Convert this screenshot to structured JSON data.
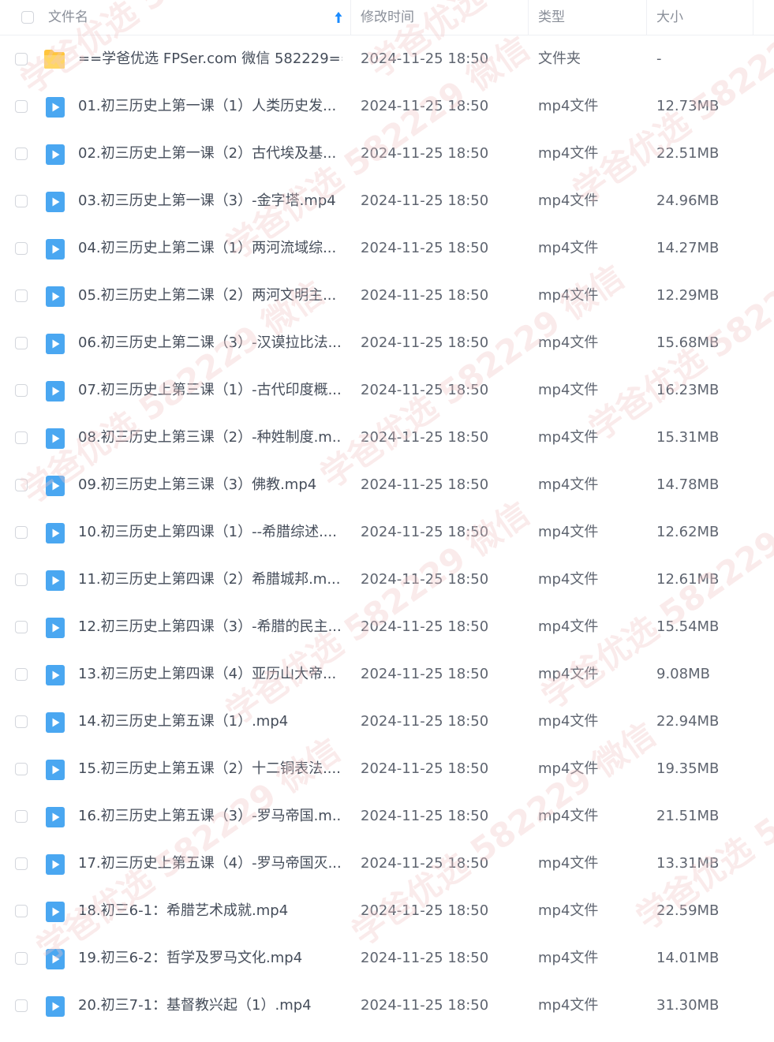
{
  "colors": {
    "accent": "#1a8bff",
    "video_icon": "#4aa7f1",
    "folder": "#ffc53d",
    "watermark": "#f0c5c5"
  },
  "header": {
    "name_label": "文件名",
    "time_label": "修改时间",
    "type_label": "类型",
    "size_label": "大小",
    "sort_icon": "arrow-up-icon"
  },
  "watermark": {
    "text": "学爸优选 582229 微信"
  },
  "files": [
    {
      "icon": "folder-icon",
      "name": "==学爸优选 FPSer.com 微信 582229==",
      "time": "2024-11-25 18:50",
      "type": "文件夹",
      "size": "-"
    },
    {
      "icon": "video-icon",
      "name": "01.初三历史上第一课（1）人类历史发...",
      "time": "2024-11-25 18:50",
      "type": "mp4文件",
      "size": "12.73MB"
    },
    {
      "icon": "video-icon",
      "name": "02.初三历史上第一课（2）古代埃及基...",
      "time": "2024-11-25 18:50",
      "type": "mp4文件",
      "size": "22.51MB"
    },
    {
      "icon": "video-icon",
      "name": "03.初三历史上第一课（3）-金字塔.mp4",
      "time": "2024-11-25 18:50",
      "type": "mp4文件",
      "size": "24.96MB"
    },
    {
      "icon": "video-icon",
      "name": "04.初三历史上第二课（1）两河流域综...",
      "time": "2024-11-25 18:50",
      "type": "mp4文件",
      "size": "14.27MB"
    },
    {
      "icon": "video-icon",
      "name": "05.初三历史上第二课（2）两河文明主...",
      "time": "2024-11-25 18:50",
      "type": "mp4文件",
      "size": "12.29MB"
    },
    {
      "icon": "video-icon",
      "name": "06.初三历史上第二课（3）-汉谟拉比法...",
      "time": "2024-11-25 18:50",
      "type": "mp4文件",
      "size": "15.68MB"
    },
    {
      "icon": "video-icon",
      "name": "07.初三历史上第三课（1）-古代印度概...",
      "time": "2024-11-25 18:50",
      "type": "mp4文件",
      "size": "16.23MB"
    },
    {
      "icon": "video-icon",
      "name": "08.初三历史上第三课（2）-种姓制度.m...",
      "time": "2024-11-25 18:50",
      "type": "mp4文件",
      "size": "15.31MB"
    },
    {
      "icon": "video-icon",
      "name": "09.初三历史上第三课（3）佛教.mp4",
      "time": "2024-11-25 18:50",
      "type": "mp4文件",
      "size": "14.78MB"
    },
    {
      "icon": "video-icon",
      "name": "10.初三历史上第四课（1）--希腊综述....",
      "time": "2024-11-25 18:50",
      "type": "mp4文件",
      "size": "12.62MB"
    },
    {
      "icon": "video-icon",
      "name": "11.初三历史上第四课（2）希腊城邦.m...",
      "time": "2024-11-25 18:50",
      "type": "mp4文件",
      "size": "12.61MB"
    },
    {
      "icon": "video-icon",
      "name": "12.初三历史上第四课（3）-希腊的民主....",
      "time": "2024-11-25 18:50",
      "type": "mp4文件",
      "size": "15.54MB"
    },
    {
      "icon": "video-icon",
      "name": "13.初三历史上第四课（4）亚历山大帝...",
      "time": "2024-11-25 18:50",
      "type": "mp4文件",
      "size": "9.08MB"
    },
    {
      "icon": "video-icon",
      "name": "14.初三历史上第五课（1）.mp4",
      "time": "2024-11-25 18:50",
      "type": "mp4文件",
      "size": "22.94MB"
    },
    {
      "icon": "video-icon",
      "name": "15.初三历史上第五课（2）十二铜表法....",
      "time": "2024-11-25 18:50",
      "type": "mp4文件",
      "size": "19.35MB"
    },
    {
      "icon": "video-icon",
      "name": "16.初三历史上第五课（3）-罗马帝国.m...",
      "time": "2024-11-25 18:50",
      "type": "mp4文件",
      "size": "21.51MB"
    },
    {
      "icon": "video-icon",
      "name": "17.初三历史上第五课（4）-罗马帝国灭...",
      "time": "2024-11-25 18:50",
      "type": "mp4文件",
      "size": "13.31MB"
    },
    {
      "icon": "video-icon",
      "name": "18.初三6-1：希腊艺术成就.mp4",
      "time": "2024-11-25 18:50",
      "type": "mp4文件",
      "size": "22.59MB"
    },
    {
      "icon": "video-icon",
      "name": "19.初三6-2：哲学及罗马文化.mp4",
      "time": "2024-11-25 18:50",
      "type": "mp4文件",
      "size": "14.01MB"
    },
    {
      "icon": "video-icon",
      "name": "20.初三7-1：基督教兴起（1）.mp4",
      "time": "2024-11-25 18:50",
      "type": "mp4文件",
      "size": "31.30MB"
    }
  ]
}
